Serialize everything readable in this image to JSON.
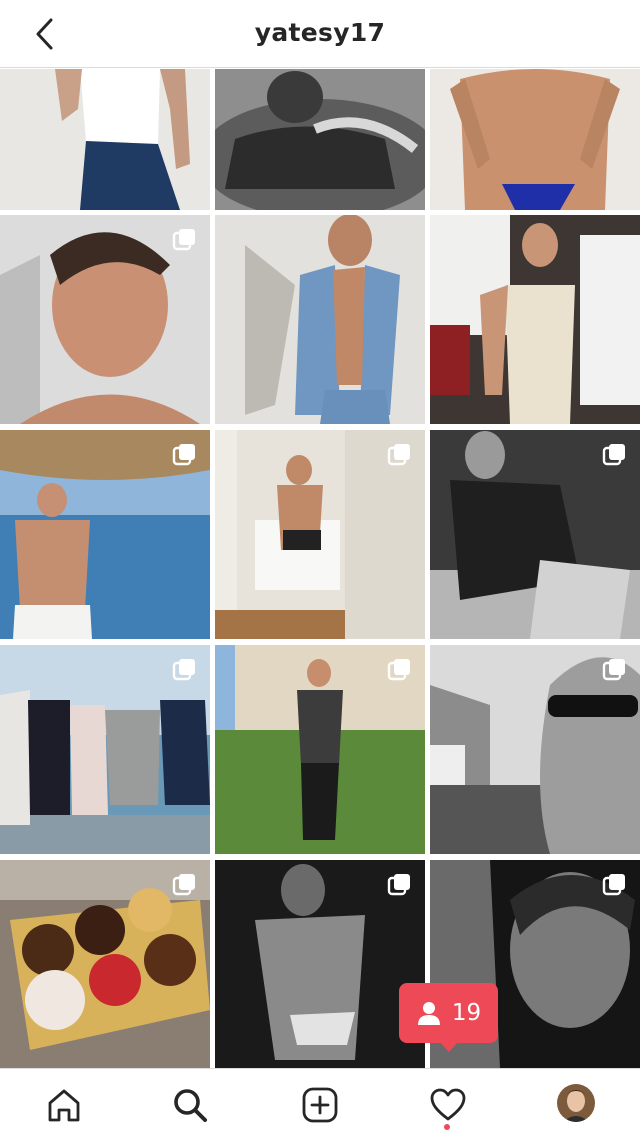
{
  "header": {
    "title": "yatesy17",
    "back_icon": "chevron-left-icon"
  },
  "posts": [
    {
      "id": 1,
      "description_icon": "photo",
      "multi": false
    },
    {
      "id": 2,
      "description_icon": "photo",
      "multi": false
    },
    {
      "id": 3,
      "description_icon": "photo",
      "multi": false
    },
    {
      "id": 4,
      "description_icon": "photo",
      "multi": true
    },
    {
      "id": 5,
      "description_icon": "photo",
      "multi": false
    },
    {
      "id": 6,
      "description_icon": "photo",
      "multi": false
    },
    {
      "id": 7,
      "description_icon": "photo",
      "multi": true
    },
    {
      "id": 8,
      "description_icon": "photo",
      "multi": true
    },
    {
      "id": 9,
      "description_icon": "photo",
      "multi": true
    },
    {
      "id": 10,
      "description_icon": "photo",
      "multi": true
    },
    {
      "id": 11,
      "description_icon": "photo",
      "multi": true
    },
    {
      "id": 12,
      "description_icon": "photo",
      "multi": true
    },
    {
      "id": 13,
      "description_icon": "photo",
      "multi": true
    },
    {
      "id": 14,
      "description_icon": "photo",
      "multi": true
    },
    {
      "id": 15,
      "description_icon": "photo",
      "multi": true
    }
  ],
  "notification": {
    "count": "19",
    "icon": "person-icon",
    "color": "#ed4956"
  },
  "tabs": [
    "home-icon",
    "search-icon",
    "add-post-icon",
    "heart-icon",
    "profile-avatar"
  ]
}
